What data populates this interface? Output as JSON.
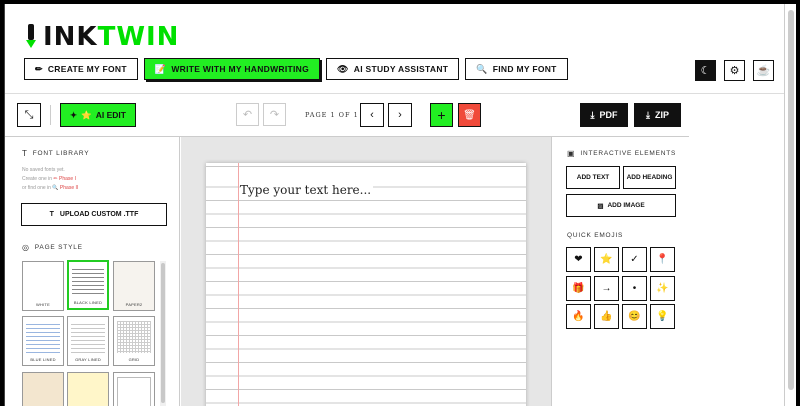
{
  "app": {
    "logo_ink": "INK",
    "logo_twin": "TWIN"
  },
  "nav": [
    {
      "label": "CREATE MY FONT",
      "icon": "✏",
      "active": false
    },
    {
      "label": "WRITE WITH MY HANDWRITING",
      "icon": "📝",
      "active": true
    },
    {
      "label": "AI STUDY ASSISTANT",
      "icon": "👁",
      "active": false
    },
    {
      "label": "FIND MY FONT",
      "icon": "🔍",
      "active": false
    }
  ],
  "toolbar": {
    "ai_edit_label": "AI EDIT",
    "page_indicator": "PAGE 1 OF 1",
    "pdf_label": "PDF",
    "zip_label": "ZIP"
  },
  "font_library": {
    "title": "FONT LIBRARY",
    "empty": "No saved fonts yet.",
    "create_prefix": "Create one in",
    "create_link": "✏ Phase I",
    "find_prefix": "or find one in",
    "find_link": "🔍 Phase II",
    "upload_label": "UPLOAD CUSTOM .TTF"
  },
  "page_style": {
    "title": "PAGE STYLE",
    "tiles": [
      {
        "label": "WHITE",
        "selected": false
      },
      {
        "label": "BLACK LINED",
        "selected": true
      },
      {
        "label": "PAPER2",
        "selected": false
      },
      {
        "label": "BLUE LINED",
        "selected": false
      },
      {
        "label": "GRAY LINED",
        "selected": false
      },
      {
        "label": "GRID",
        "selected": false
      },
      {
        "label": "",
        "selected": false
      },
      {
        "label": "",
        "selected": false
      },
      {
        "label": "",
        "selected": false
      }
    ]
  },
  "canvas": {
    "placeholder": "Type your text here..."
  },
  "interactive": {
    "title": "INTERACTIVE ELEMENTS",
    "add_text": "ADD TEXT",
    "add_heading": "ADD HEADING",
    "add_image": "ADD IMAGE"
  },
  "quick_emojis": {
    "title": "QUICK EMOJIS",
    "items": [
      "❤",
      "⭐",
      "✓",
      "📍",
      "🎁",
      "→",
      "•",
      "✨",
      "🔥",
      "👍",
      "😊",
      "💡"
    ]
  },
  "colors": {
    "accent": "#22ee22",
    "danger": "#f04a3a",
    "dark": "#111111"
  }
}
